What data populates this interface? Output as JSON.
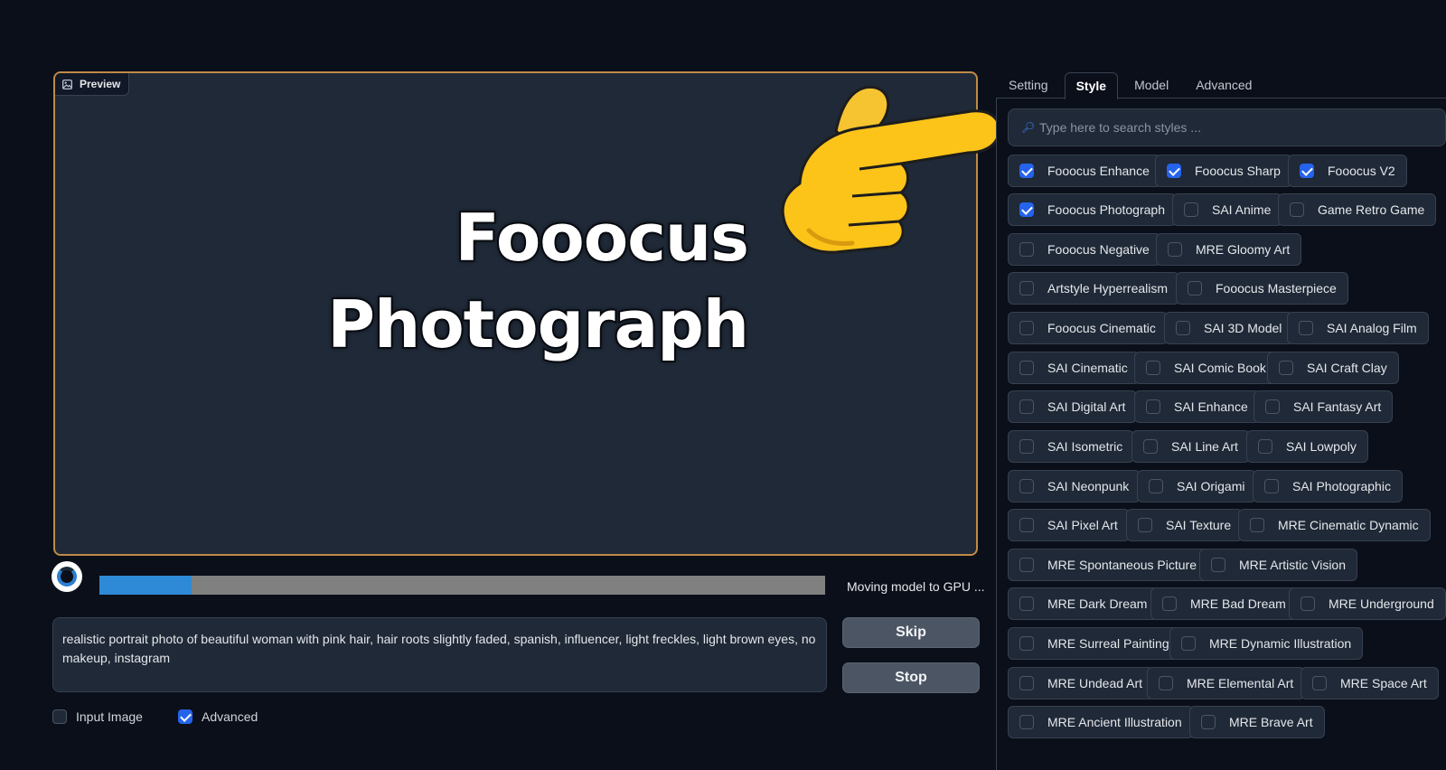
{
  "preview": {
    "label": "Preview",
    "overlay_line1": "Fooocus",
    "overlay_line2": "Photograph"
  },
  "progress": {
    "fraction": 0.127,
    "label": "Moving model to GPU ..."
  },
  "prompt": {
    "text": "realistic portrait photo of beautiful woman with pink hair, hair roots slightly faded, spanish, influencer, light freckles, light brown eyes, no makeup, instagram"
  },
  "buttons": {
    "skip": "Skip",
    "stop": "Stop"
  },
  "options": {
    "input_image": {
      "label": "Input Image",
      "checked": false
    },
    "advanced": {
      "label": "Advanced",
      "checked": true
    }
  },
  "tabs": [
    {
      "label": "Setting",
      "active": false
    },
    {
      "label": "Style",
      "active": true
    },
    {
      "label": "Model",
      "active": false
    },
    {
      "label": "Advanced",
      "active": false
    }
  ],
  "style_search": {
    "placeholder": "Type here to search styles ..."
  },
  "styles": [
    {
      "label": "Fooocus Enhance",
      "checked": true
    },
    {
      "label": "Fooocus Sharp",
      "checked": true
    },
    {
      "label": "Fooocus V2",
      "checked": true
    },
    {
      "label": "Fooocus Photograph",
      "checked": true
    },
    {
      "label": "SAI Anime",
      "checked": false
    },
    {
      "label": "Game Retro Game",
      "checked": false
    },
    {
      "label": "Fooocus Negative",
      "checked": false
    },
    {
      "label": "MRE Gloomy Art",
      "checked": false
    },
    {
      "label": "Artstyle Hyperrealism",
      "checked": false
    },
    {
      "label": "Fooocus Masterpiece",
      "checked": false
    },
    {
      "label": "Fooocus Cinematic",
      "checked": false
    },
    {
      "label": "SAI 3D Model",
      "checked": false
    },
    {
      "label": "SAI Analog Film",
      "checked": false
    },
    {
      "label": "SAI Cinematic",
      "checked": false
    },
    {
      "label": "SAI Comic Book",
      "checked": false
    },
    {
      "label": "SAI Craft Clay",
      "checked": false
    },
    {
      "label": "SAI Digital Art",
      "checked": false
    },
    {
      "label": "SAI Enhance",
      "checked": false
    },
    {
      "label": "SAI Fantasy Art",
      "checked": false
    },
    {
      "label": "SAI Isometric",
      "checked": false
    },
    {
      "label": "SAI Line Art",
      "checked": false
    },
    {
      "label": "SAI Lowpoly",
      "checked": false
    },
    {
      "label": "SAI Neonpunk",
      "checked": false
    },
    {
      "label": "SAI Origami",
      "checked": false
    },
    {
      "label": "SAI Photographic",
      "checked": false
    },
    {
      "label": "SAI Pixel Art",
      "checked": false
    },
    {
      "label": "SAI Texture",
      "checked": false
    },
    {
      "label": "MRE Cinematic Dynamic",
      "checked": false
    },
    {
      "label": "MRE Spontaneous Picture",
      "checked": false
    },
    {
      "label": "MRE Artistic Vision",
      "checked": false
    },
    {
      "label": "MRE Dark Dream",
      "checked": false
    },
    {
      "label": "MRE Bad Dream",
      "checked": false
    },
    {
      "label": "MRE Underground",
      "checked": false
    },
    {
      "label": "MRE Surreal Painting",
      "checked": false
    },
    {
      "label": "MRE Dynamic Illustration",
      "checked": false
    },
    {
      "label": "MRE Undead Art",
      "checked": false
    },
    {
      "label": "MRE Elemental Art",
      "checked": false
    },
    {
      "label": "MRE Space Art",
      "checked": false
    },
    {
      "label": "MRE Ancient Illustration",
      "checked": false
    },
    {
      "label": "MRE Brave Art",
      "checked": false
    }
  ],
  "icons": {
    "preview": "image-icon",
    "search": "magnifier-icon",
    "overlay": "pointing-hand-icon",
    "progress": "loading-spinner-icon"
  },
  "colors": {
    "accent": "#2563eb",
    "preview_border": "#c08a47",
    "progress_fill": "#2e8ad6"
  }
}
